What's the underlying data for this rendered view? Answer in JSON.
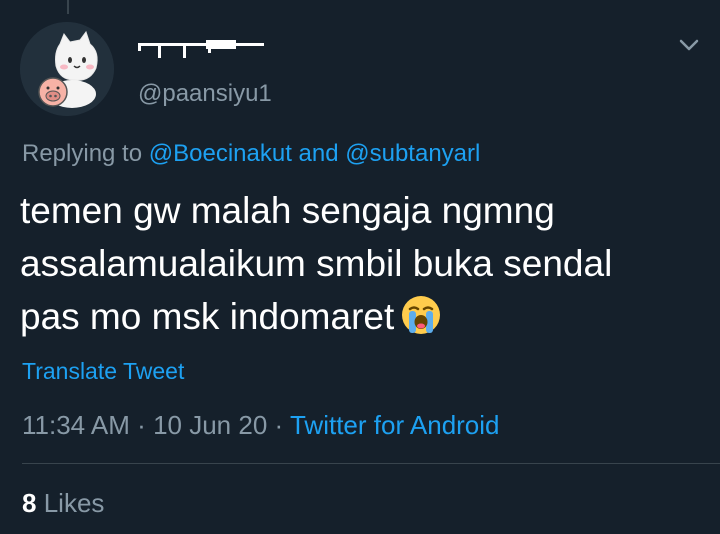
{
  "tweet": {
    "handle": "@paansiyu1",
    "reply": {
      "prefix": "Replying to",
      "user1": "@Boecinakut",
      "conjunction": "and",
      "user2": "@subtanyarl"
    },
    "text_lines": [
      "temen gw malah sengaja ngmng",
      "assalamualaikum smbil buka sendal",
      "pas mo msk indomaret"
    ],
    "emoji": "loudly-crying-face",
    "translate_label": "Translate Tweet",
    "meta": {
      "time": "11:34 AM",
      "separator": "·",
      "date": "10 Jun 20",
      "source": "Twitter for Android"
    },
    "likes": {
      "count": "8",
      "label": "Likes"
    }
  },
  "colors": {
    "background": "#15202b",
    "text_primary": "#ffffff",
    "text_secondary": "#8899a6",
    "accent": "#1da1f2",
    "divider": "#38444d"
  }
}
